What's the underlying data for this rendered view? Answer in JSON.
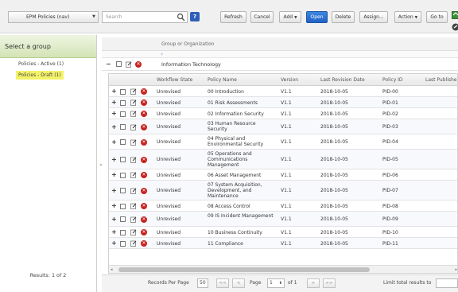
{
  "toolbar": {
    "nav_select": "EPM Policies (nav)",
    "search_placeholder": "Search",
    "help_label": "?",
    "buttons": {
      "refresh": "Refresh",
      "cancel": "Cancel",
      "add": "Add",
      "open": "Open",
      "delete": "Delete",
      "assign": "Assign...",
      "action": "Action",
      "goto": "Go to"
    }
  },
  "sidebar": {
    "title": "Select a group",
    "items": [
      {
        "label": "Policies - Active (1)",
        "selected": false
      },
      {
        "label": "Policies - Draft (1)",
        "selected": true
      }
    ],
    "results": "Results: 1 of 2"
  },
  "main": {
    "group_header": "Group or Organization",
    "group_name": "Information Technology",
    "columns": [
      "Workflow State",
      "Policy Name",
      "Version",
      "Last Revision Date",
      "Policy ID",
      "Last Publishe"
    ],
    "rows": [
      {
        "state": "Unrevised",
        "name": "00 Introduction",
        "version": "V1.1",
        "date": "2018-10-05",
        "id": "PID-00"
      },
      {
        "state": "Unrevised",
        "name": "01 Risk Assessments",
        "version": "V1.1",
        "date": "2018-10-05",
        "id": "PID-01"
      },
      {
        "state": "Unrevised",
        "name": "02 Information Security",
        "version": "V1.1",
        "date": "2018-10-05",
        "id": "PID-02"
      },
      {
        "state": "Unrevised",
        "name": "03 Human Resource Security",
        "version": "V1.1",
        "date": "2018-10-05",
        "id": "PID-03"
      },
      {
        "state": "Unrevised",
        "name": "04 Physical and Environmental Security",
        "version": "V1.1",
        "date": "2018-10-05",
        "id": "PID-04"
      },
      {
        "state": "Unrevised",
        "name": "05 Operations and Communications Management",
        "version": "V1.1",
        "date": "2018-10-05",
        "id": "PID-05"
      },
      {
        "state": "Unrevised",
        "name": "06 Asset Management",
        "version": "V1.1",
        "date": "2018-10-05",
        "id": "PID-06"
      },
      {
        "state": "Unrevised",
        "name": "07 System Acquisition, Development, and Maintenance",
        "version": "V1.1",
        "date": "2018-10-05",
        "id": "PID-07"
      },
      {
        "state": "Unrevised",
        "name": "08 Access Control",
        "version": "V1.1",
        "date": "2018-10-05",
        "id": "PID-08"
      },
      {
        "state": "Unrevised",
        "name": "09 IS Incident Management",
        "version": "V1.1",
        "date": "2018-10-05",
        "id": "PID-09"
      },
      {
        "state": "Unrevised",
        "name": "10 Business Continuity",
        "version": "V1.1",
        "date": "2018-10-05",
        "id": "PID-10"
      },
      {
        "state": "Unrevised",
        "name": "11 Compliance",
        "version": "V1.1",
        "date": "2018-10-05",
        "id": "PID-11"
      }
    ]
  },
  "pager": {
    "records_label": "Records Per Page",
    "records_value": "50",
    "first": "<<",
    "prev": "<",
    "page_label": "Page",
    "page_value": "1",
    "of_label": "of 1",
    "next": ">",
    "last": ">>",
    "limit_label": "Limit total results to"
  },
  "colors": {
    "primary_button": "#1f63c4",
    "selected_group": "#f3f36a",
    "delete_icon": "#c9211e",
    "sidebar_header": "#d3e4b5"
  }
}
